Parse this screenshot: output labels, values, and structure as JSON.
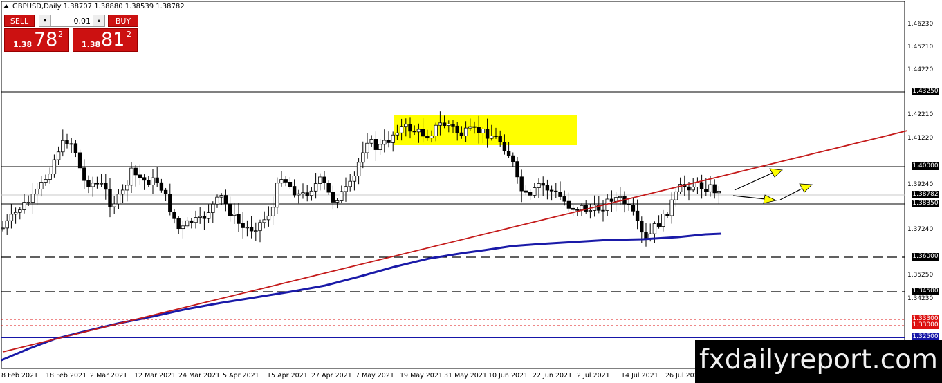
{
  "window": {
    "title": "GBPUSD,Daily  1.38707 1.38880 1.38539 1.38782"
  },
  "trade_panel": {
    "sell_label": "SELL",
    "buy_label": "BUY",
    "lot_value": "0.01",
    "lot_down_icon": "arrow-down-icon",
    "lot_up_icon": "arrow-up-icon",
    "sell_price": {
      "prefix": "1.38",
      "big": "78",
      "sup": "2"
    },
    "buy_price": {
      "prefix": "1.38",
      "big": "81",
      "sup": "2"
    }
  },
  "price_axis": {
    "labels": [
      "1.46230",
      "1.45210",
      "1.44220",
      "1.42210",
      "1.41220",
      "1.39240",
      "1.37240",
      "1.35250",
      "1.34230"
    ],
    "highlight_labels": {
      "l43250": "1.43250",
      "l40000": "1.40000",
      "current": "1.38782",
      "l38350": "1.38350",
      "l36000": "1.36000",
      "l34500": "1.34500",
      "l33300": "1.33300",
      "l33000": "1.33000",
      "l32500": "1.32500"
    }
  },
  "time_axis": {
    "labels": [
      "8 Feb 2021",
      "18 Feb 2021",
      "2 Mar 2021",
      "12 Mar 2021",
      "24 Mar 2021",
      "5 Apr 2021",
      "15 Apr 2021",
      "27 Apr 2021",
      "7 May 2021",
      "19 May 2021",
      "31 May 2021",
      "10 Jun 2021",
      "22 Jun 2021",
      "2 Jul 2021",
      "14 Jul 2021",
      "26 Jul 2021"
    ]
  },
  "colors": {
    "bull_candle": "#ffffff",
    "bear_candle": "#000000",
    "trendline": "#c41a1a",
    "moving_average": "#1a1aa8",
    "highlight_zone": "#ffff00",
    "arrow_fill": "#ffff00"
  },
  "watermark": {
    "text": "fxdailyreport.com"
  }
}
